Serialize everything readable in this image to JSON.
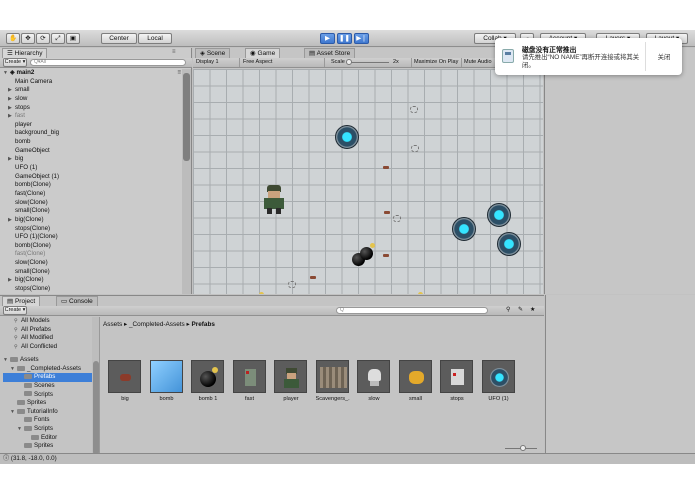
{
  "toolbar": {
    "pivot_label": "Center",
    "space_label": "Local",
    "collab_label": "Collab ▾",
    "account_label": "Account",
    "layers_label": "Layers",
    "layout_label": "Layout"
  },
  "hierarchy": {
    "title": "Hierarchy",
    "create_label": "Create ▾",
    "search_placeholder": "Q▾All",
    "scene": "main2",
    "items": [
      {
        "label": "Main Camera",
        "arrow": false,
        "dim": false
      },
      {
        "label": "small",
        "arrow": true,
        "dim": false
      },
      {
        "label": "slow",
        "arrow": true,
        "dim": false
      },
      {
        "label": "stops",
        "arrow": true,
        "dim": false
      },
      {
        "label": "fast",
        "arrow": true,
        "dim": true
      },
      {
        "label": "player",
        "arrow": false,
        "dim": false
      },
      {
        "label": "background_big",
        "arrow": false,
        "dim": false
      },
      {
        "label": "bomb",
        "arrow": false,
        "dim": false
      },
      {
        "label": "GameObject",
        "arrow": false,
        "dim": false
      },
      {
        "label": "big",
        "arrow": true,
        "dim": false
      },
      {
        "label": "UFO (1)",
        "arrow": false,
        "dim": false
      },
      {
        "label": "GameObject (1)",
        "arrow": false,
        "dim": false
      },
      {
        "label": "bomb(Clone)",
        "arrow": false,
        "dim": false
      },
      {
        "label": "fast(Clone)",
        "arrow": false,
        "dim": false
      },
      {
        "label": "slow(Clone)",
        "arrow": false,
        "dim": false
      },
      {
        "label": "small(Clone)",
        "arrow": false,
        "dim": false
      },
      {
        "label": "big(Clone)",
        "arrow": true,
        "dim": false
      },
      {
        "label": "stops(Clone)",
        "arrow": false,
        "dim": false
      },
      {
        "label": "UFO (1)(Clone)",
        "arrow": false,
        "dim": false
      },
      {
        "label": "bomb(Clone)",
        "arrow": false,
        "dim": false
      },
      {
        "label": "fast(Clone)",
        "arrow": false,
        "dim": true
      },
      {
        "label": "slow(Clone)",
        "arrow": false,
        "dim": false
      },
      {
        "label": "small(Clone)",
        "arrow": false,
        "dim": false
      },
      {
        "label": "big(Clone)",
        "arrow": true,
        "dim": false
      },
      {
        "label": "stops(Clone)",
        "arrow": false,
        "dim": false
      }
    ]
  },
  "game": {
    "tabs": {
      "scene": "Scene",
      "game": "Game",
      "store": "Asset Store"
    },
    "display": "Display 1",
    "aspect": "Free Aspect",
    "scale_label": "Scale",
    "scale_value": "2x",
    "maximize_label": "Maximize On Play",
    "mute_label": "Mute Audio"
  },
  "project": {
    "tabs": {
      "project": "Project",
      "console": "Console"
    },
    "create_label": "Create ▾",
    "search_placeholder": "Q",
    "breadcrumb": [
      "Assets",
      "_Completed-Assets",
      "Prefabs"
    ],
    "favorites": [
      "All Models",
      "All Prefabs",
      "All Modified",
      "All Conflicted"
    ],
    "tree": [
      {
        "label": "Assets",
        "indent": 0,
        "arrow": "▼",
        "sel": false
      },
      {
        "label": "_Completed-Assets",
        "indent": 1,
        "arrow": "▼",
        "sel": false
      },
      {
        "label": "Prefabs",
        "indent": 2,
        "arrow": "",
        "sel": true
      },
      {
        "label": "Scenes",
        "indent": 2,
        "arrow": "",
        "sel": false
      },
      {
        "label": "Scripts",
        "indent": 2,
        "arrow": "",
        "sel": false
      },
      {
        "label": "Sprites",
        "indent": 1,
        "arrow": "",
        "sel": false
      },
      {
        "label": "TutorialInfo",
        "indent": 1,
        "arrow": "▼",
        "sel": false
      },
      {
        "label": "Fonts",
        "indent": 2,
        "arrow": "",
        "sel": false
      },
      {
        "label": "Scripts",
        "indent": 2,
        "arrow": "▼",
        "sel": false
      },
      {
        "label": "Editor",
        "indent": 3,
        "arrow": "",
        "sel": false
      },
      {
        "label": "Sprites",
        "indent": 2,
        "arrow": "",
        "sel": false
      }
    ],
    "assets": [
      {
        "label": "big",
        "icon": "meat-icon"
      },
      {
        "label": "bomb",
        "icon": "cube-icon"
      },
      {
        "label": "bomb 1",
        "icon": "bomb-icon"
      },
      {
        "label": "fast",
        "icon": "zombie-icon"
      },
      {
        "label": "player",
        "icon": "player-icon"
      },
      {
        "label": "Scavengers_...",
        "icon": "spritesheet-icon"
      },
      {
        "label": "slow",
        "icon": "skull-icon"
      },
      {
        "label": "small",
        "icon": "coin-icon"
      },
      {
        "label": "stops",
        "icon": "enemy-icon"
      },
      {
        "label": "UFO (1)",
        "icon": "ufo-icon"
      }
    ]
  },
  "status": {
    "text": "(31.8, -18.0, 0.0)"
  },
  "notification": {
    "title": "磁盘没有正常推出",
    "body": "请先推出“NO NAME”再断开连接或将其关闭。",
    "close_label": "关闭"
  }
}
